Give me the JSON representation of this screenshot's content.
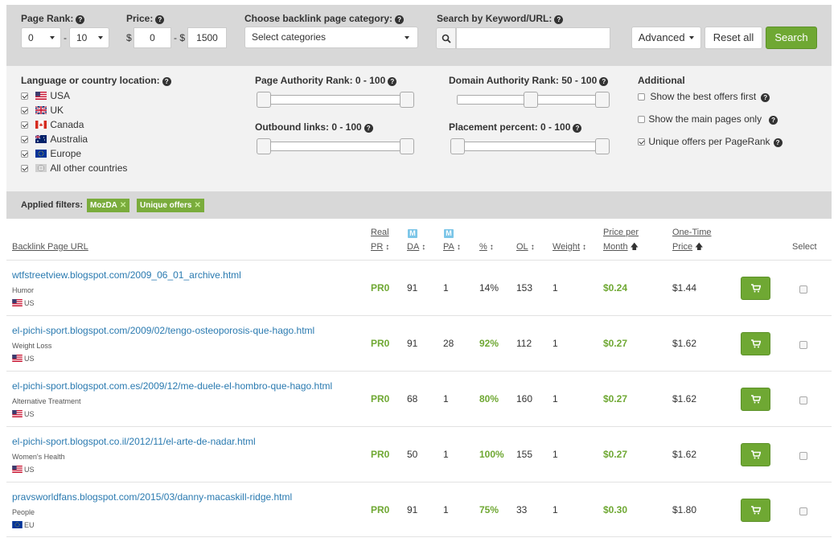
{
  "topbar": {
    "page_rank_label": "Page Rank:",
    "page_rank_from": "0",
    "page_rank_dash": "-",
    "page_rank_to": "10",
    "price_label": "Price:",
    "currency": "$",
    "price_from": "0",
    "price_sep": "- $",
    "price_to": "1500",
    "category_label": "Choose backlink page category:",
    "category_value": "Select categories",
    "search_label": "Search by Keyword/URL:",
    "search_value": "",
    "advanced_label": "Advanced",
    "reset_label": "Reset all",
    "search_button_label": "Search"
  },
  "filters": {
    "language_label": "Language or country location:",
    "countries": [
      {
        "name": "USA",
        "checked": true,
        "flag": "us-flag-icon"
      },
      {
        "name": "UK",
        "checked": true,
        "flag": "uk-flag-icon"
      },
      {
        "name": "Canada",
        "checked": true,
        "flag": "canada-flag-icon"
      },
      {
        "name": "Australia",
        "checked": true,
        "flag": "australia-flag-icon"
      },
      {
        "name": "Europe",
        "checked": true,
        "flag": "eu-flag-icon"
      },
      {
        "name": "All other countries",
        "checked": true,
        "flag": "globe-flag-icon"
      }
    ],
    "pa_label": "Page Authority Rank: 0 - 100",
    "ol_label": "Outbound links: 0 - 100",
    "da_label": "Domain Authority Rank: 50 - 100",
    "placement_label": "Placement percent: 0 - 100",
    "additional_label": "Additional",
    "options": [
      {
        "label": "Show the best offers first",
        "checked": false
      },
      {
        "label": "Show the main pages only",
        "checked": false
      },
      {
        "label": "Unique offers per PageRank",
        "checked": true
      }
    ]
  },
  "applied": {
    "label": "Applied filters:",
    "tags": [
      "MozDA",
      "Unique offers"
    ]
  },
  "table": {
    "headers": {
      "url": "Backlink Page URL",
      "real": "Real",
      "pr": "PR",
      "da": "DA",
      "pa": "PA",
      "pct": "%",
      "ol": "OL",
      "weight": "Weight",
      "price_per": "Price per",
      "month": "Month",
      "one_time": "One-Time",
      "price": "Price",
      "select": "Select",
      "moz_icon_glyph": "M"
    },
    "rows": [
      {
        "url": "wtfstreetview.blogspot.com/2009_06_01_archive.html",
        "category": "Humor",
        "country": "US",
        "pr": "PR0",
        "da": "91",
        "pa": "1",
        "pct": "14%",
        "pct_highlight": false,
        "ol": "153",
        "weight": "1",
        "monthly": "$0.24",
        "one_time": "$1.44"
      },
      {
        "url": "el-pichi-sport.blogspot.com/2009/02/tengo-osteoporosis-que-hago.html",
        "category": "Weight Loss",
        "country": "US",
        "pr": "PR0",
        "da": "91",
        "pa": "28",
        "pct": "92%",
        "pct_highlight": true,
        "ol": "112",
        "weight": "1",
        "monthly": "$0.27",
        "one_time": "$1.62"
      },
      {
        "url": "el-pichi-sport.blogspot.com.es/2009/12/me-duele-el-hombro-que-hago.html",
        "category": "Alternative Treatment",
        "country": "US",
        "pr": "PR0",
        "da": "68",
        "pa": "1",
        "pct": "80%",
        "pct_highlight": true,
        "ol": "160",
        "weight": "1",
        "monthly": "$0.27",
        "one_time": "$1.62"
      },
      {
        "url": "el-pichi-sport.blogspot.co.il/2012/11/el-arte-de-nadar.html",
        "category": "Women's Health",
        "country": "US",
        "pr": "PR0",
        "da": "50",
        "pa": "1",
        "pct": "100%",
        "pct_highlight": true,
        "ol": "155",
        "weight": "1",
        "monthly": "$0.27",
        "one_time": "$1.62"
      },
      {
        "url": "pravsworldfans.blogspot.com/2015/03/danny-macaskill-ridge.html",
        "category": "People",
        "country": "EU",
        "pr": "PR0",
        "da": "91",
        "pa": "1",
        "pct": "75%",
        "pct_highlight": true,
        "ol": "33",
        "weight": "1",
        "monthly": "$0.30",
        "one_time": "$1.80"
      }
    ]
  },
  "colors": {
    "accent_green": "#6fa833",
    "link_blue": "#2a7ab0",
    "bar_gray": "#d8d8d8",
    "panel_gray": "#f2f2f2",
    "moz_blue": "#7cc6e8"
  }
}
